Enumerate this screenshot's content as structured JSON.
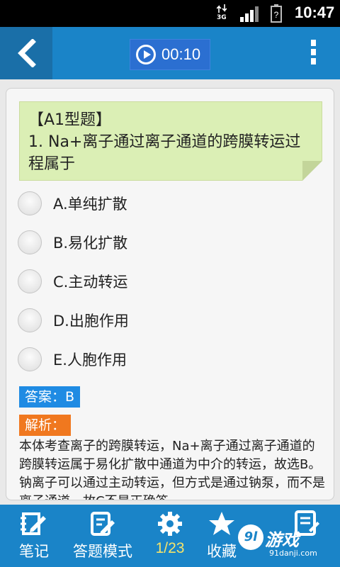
{
  "status_bar": {
    "network_label": "3G",
    "time": "10:47"
  },
  "header": {
    "timer": "00:10"
  },
  "question": {
    "type_label": "【A1型题】",
    "text": "1. Na+离子通过离子通道的跨膜转运过程属于"
  },
  "options": [
    {
      "label": "A.单纯扩散"
    },
    {
      "label": "B.易化扩散"
    },
    {
      "label": "C.主动转运"
    },
    {
      "label": "D.出胞作用"
    },
    {
      "label": "E.人胞作用"
    }
  ],
  "answer": "答案：B",
  "analysis": {
    "title": "解析：",
    "text": "本体考查离子的跨膜转运，Na+离子通过离子通道的跨膜转运属于易化扩散中通道为中介的转运，故选B。钠离子可以通过主动转运，但方式是通过钠泵，而不是离子通道，故C不是正确答"
  },
  "bottom_bar": {
    "tabs": [
      {
        "label": "笔记",
        "icon": "note-icon"
      },
      {
        "label": "答题模式",
        "icon": "edit-icon"
      },
      {
        "label": "1/23",
        "icon": "gear-icon"
      },
      {
        "label": "收藏",
        "icon": "star-icon"
      },
      {
        "label": "",
        "icon": "list-icon"
      }
    ]
  },
  "watermark": {
    "brand": "游戏",
    "logo_text": "9l",
    "site": "91danji.com"
  },
  "colors": {
    "header": "#1a84c8",
    "question_bg": "#dbefb5",
    "answer_tag": "#1f8be3",
    "analysis_tag": "#f0781f"
  }
}
